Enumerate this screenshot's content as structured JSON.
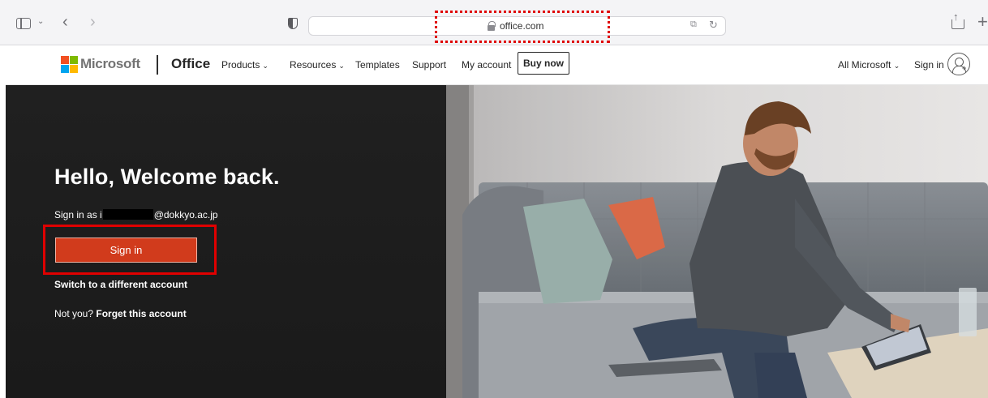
{
  "browser": {
    "url": "office.com",
    "url_highlighted": true
  },
  "header": {
    "brand": "Microsoft",
    "product": "Office",
    "nav": [
      {
        "label": "Products",
        "dropdown": true
      },
      {
        "label": "Resources",
        "dropdown": true
      },
      {
        "label": "Templates",
        "dropdown": false
      },
      {
        "label": "Support",
        "dropdown": false
      },
      {
        "label": "My account",
        "dropdown": false
      }
    ],
    "buy_now": "Buy now",
    "all_microsoft": "All Microsoft",
    "sign_in": "Sign in"
  },
  "hero": {
    "title": "Hello, Welcome back.",
    "signin_as_prefix": "Sign in as i",
    "signin_as_domain": "@dokkyo.ac.jp",
    "signin_button": "Sign in",
    "signin_highlighted": true,
    "switch_account": "Switch to a different account",
    "not_you_prefix": "Not you?",
    "forget_account": "Forget this account"
  },
  "colors": {
    "signin_button": "#d13b1c",
    "highlight": "#e00000",
    "hero_bg": "#1d1d1d"
  },
  "icons": [
    "sidebar-icon",
    "chevron-down-icon",
    "back-icon",
    "forward-icon",
    "shield-icon",
    "lock-icon",
    "translate-icon",
    "reload-icon",
    "share-icon",
    "new-tab-icon",
    "microsoft-logo-icon",
    "account-icon"
  ]
}
